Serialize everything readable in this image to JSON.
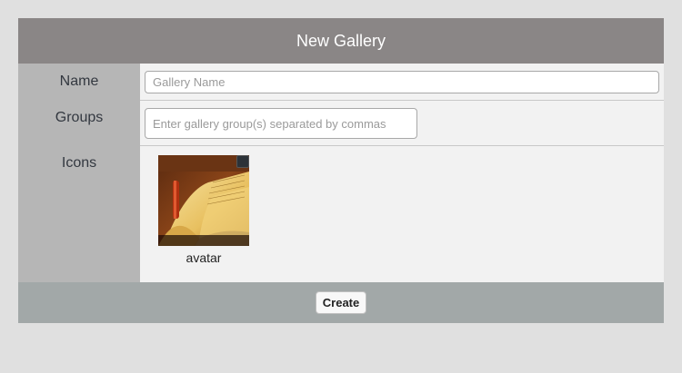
{
  "dialog": {
    "title": "New Gallery"
  },
  "form": {
    "name_label": "Name",
    "name_placeholder": "Gallery Name",
    "name_value": "",
    "groups_label": "Groups",
    "groups_placeholder": "Enter gallery group(s) separated by commas",
    "groups_value": "",
    "icons_label": "Icons",
    "icons": [
      {
        "label": "avatar",
        "image": "open-book-photo",
        "selected": true
      }
    ]
  },
  "footer": {
    "create_label": "Create"
  }
}
